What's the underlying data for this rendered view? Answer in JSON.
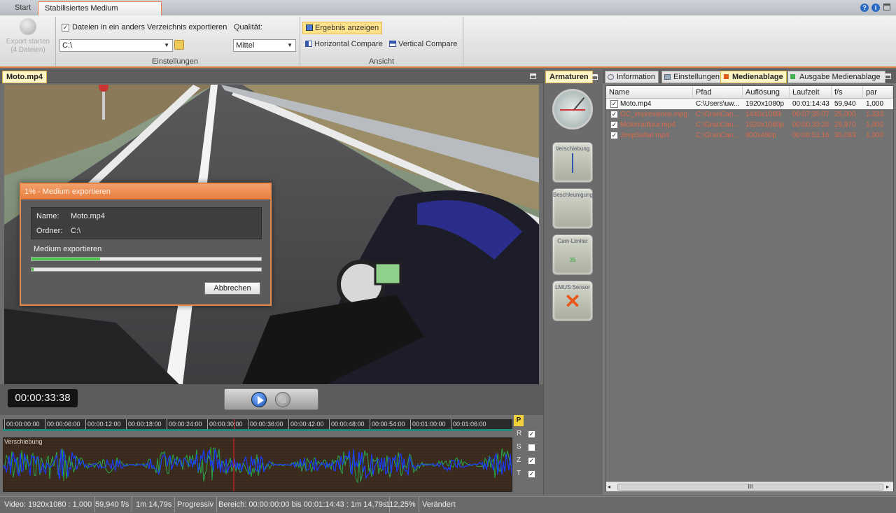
{
  "tabs": {
    "start": "Start",
    "active": "Stabilisiertes Medium exportieren"
  },
  "ribbon": {
    "export_button": "Export starten",
    "export_sub": "(4 Dateien)",
    "export_other_dir_label": "Dateien in ein anders Verzeichnis exportieren",
    "export_other_dir_checked": true,
    "path_value": "C:\\",
    "group_settings": "Einstellungen",
    "quality_label": "Qualität:",
    "quality_value": "Mittel",
    "show_result": "Ergebnis anzeigen",
    "horizontal_compare": "Horizontal Compare",
    "vertical_compare": "Vertical Compare",
    "group_view": "Ansicht"
  },
  "video_panel": {
    "title": "Moto.mp4",
    "timecode": "00:00:33:38"
  },
  "dialog": {
    "title": "1% - Medium exportieren",
    "name_label": "Name:",
    "name_value": "Moto.mp4",
    "folder_label": "Ordner:",
    "folder_value": "C:\\",
    "progress_label": "Medium exportieren",
    "progress1": 0.3,
    "progress2": 0.01,
    "cancel": "Abbrechen"
  },
  "timeline": {
    "ticks": [
      "00:00:00:00",
      "00:00:06:00",
      "00:00:12:00",
      "00:00:18:00",
      "00:00:24:00",
      "00:00:30:00",
      "00:00:36:00",
      "00:00:42:00",
      "00:00:48:00",
      "00:00:54:00",
      "00:01:00:00",
      "00:01:06:00"
    ],
    "track_label": "Verschiebung",
    "p_label": "P",
    "toggles": [
      {
        "label": "R",
        "checked": true
      },
      {
        "label": "S",
        "checked": false
      },
      {
        "label": "Z",
        "checked": true
      },
      {
        "label": "T",
        "checked": true
      }
    ]
  },
  "instruments": {
    "title": "Armaturen",
    "items": [
      "Verschiebung",
      "Beschleunigung",
      "Cam-Limiter",
      "LMUS Sensor"
    ],
    "cam_value": "35"
  },
  "media": {
    "tabs": [
      "Information",
      "Einstellungen",
      "Medienablage",
      "Ausgabe Medienablage"
    ],
    "active_tab": "Medienablage",
    "columns": [
      "Name",
      "Pfad",
      "Auflösung",
      "Laufzeit",
      "f/s",
      "par"
    ],
    "rows": [
      {
        "name": "Moto.mp4",
        "path": "C:\\Users\\uw...",
        "res": "1920x1080p",
        "dur": "00:01:14:43",
        "fps": "59,940",
        "par": "1,000",
        "checked": true,
        "selected": true
      },
      {
        "name": "GC_impressions.mpg",
        "path": "C:\\GranCan...",
        "res": "1440x1080i",
        "dur": "00:07:35:07",
        "fps": "25,000",
        "par": "1,333",
        "checked": true,
        "selected": false
      },
      {
        "name": "Motorradtour.mp4",
        "path": "C:\\GranCan...",
        "res": "1920x1080p",
        "dur": "00:00:33:20",
        "fps": "29,970",
        "par": "1,000",
        "checked": true,
        "selected": false
      },
      {
        "name": "JeepSafari.mp4",
        "path": "C:\\GranCan...",
        "res": "800x480p",
        "dur": "00:00:51:16",
        "fps": "30,083",
        "par": "1,000",
        "checked": true,
        "selected": false
      }
    ],
    "scroll_grip": "III"
  },
  "status": {
    "video": "Video: 1920x1080 : 1,000",
    "fps": "59,940 f/s",
    "duration": "1m 14,79s",
    "scan": "Progressiv",
    "range": "Bereich: 00:00:00:00 bis 00:01:14:43 : 1m 14,79s",
    "zoom": "112,25%",
    "state": "Verändert"
  },
  "colors": {
    "accent": "#e67d3c",
    "highlight": "#fff6c7",
    "waveform_blue": "#1a3cff",
    "waveform_green": "#2aa84a",
    "row_error": "#d96a4a"
  }
}
